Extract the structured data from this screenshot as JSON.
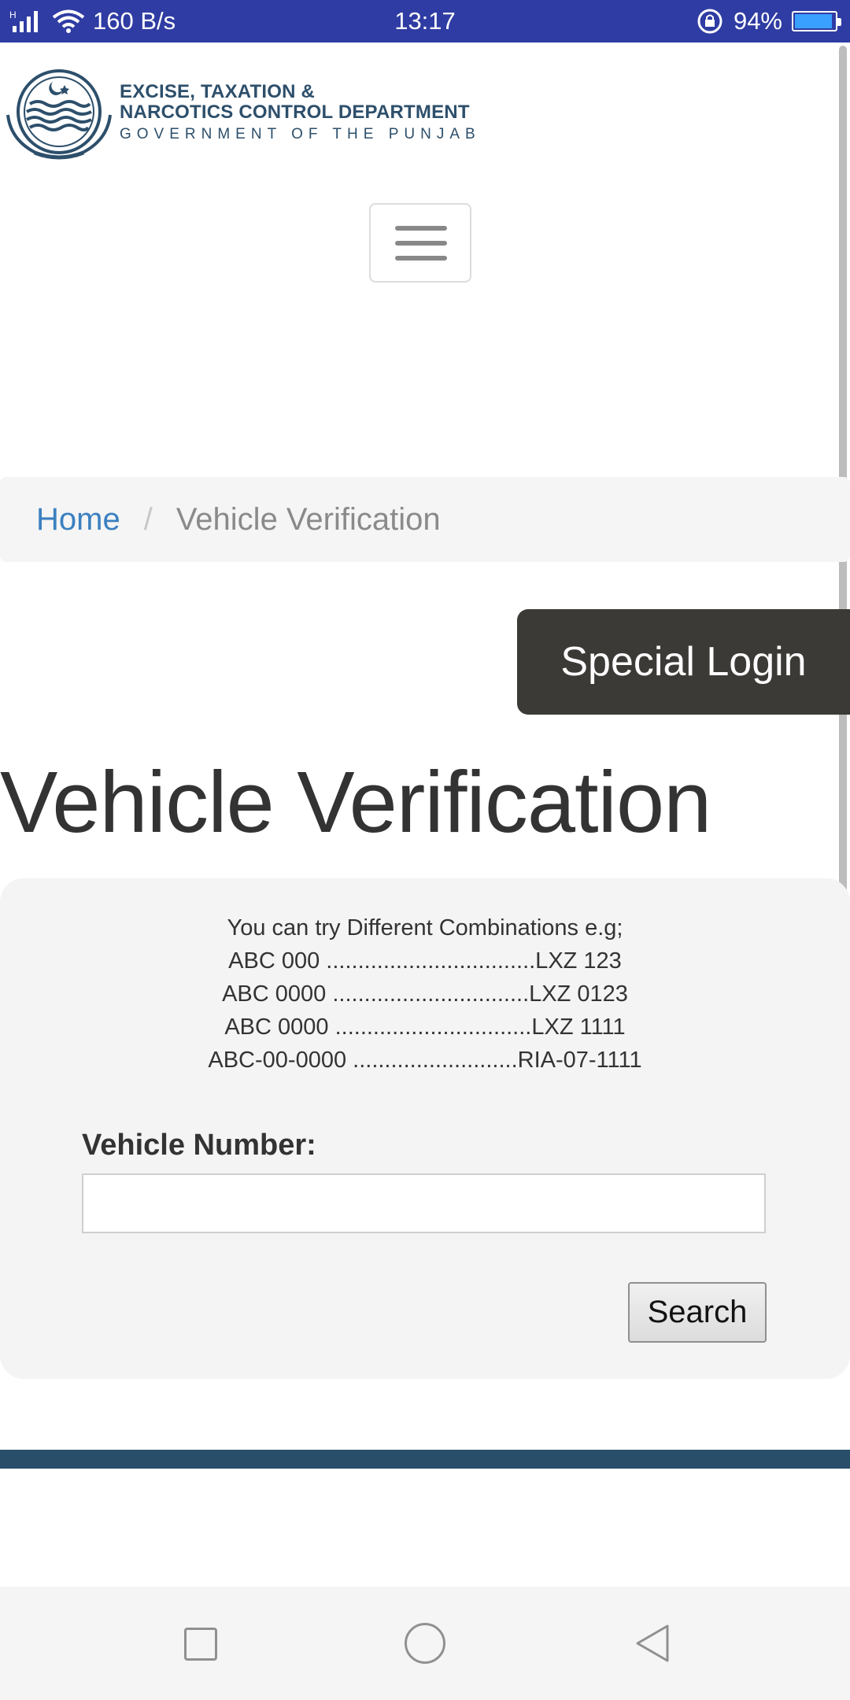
{
  "status_bar": {
    "network": "H",
    "speed": "160 B/s",
    "time": "13:17",
    "battery_percent": "94%",
    "battery_level": 0.94
  },
  "header": {
    "org_line1": "EXCISE, TAXATION &",
    "org_line2": "NARCOTICS CONTROL DEPARTMENT",
    "org_line3": "GOVERNMENT OF THE PUNJAB",
    "logo_icon": "punjab-emblem-icon",
    "menu_icon": "hamburger-menu-icon"
  },
  "breadcrumb": {
    "home": "Home",
    "separator": "/",
    "current": "Vehicle Verification"
  },
  "special_login": "Special Login",
  "page_title": "Vehicle Verification",
  "examples": {
    "intro": "You can try Different Combinations e.g;",
    "lines": [
      "ABC 000 .................................LXZ 123",
      "ABC 0000 ...............................LXZ 0123",
      "ABC 0000 ...............................LXZ 1111",
      "ABC-00-0000 ..........................RIA-07-1111"
    ]
  },
  "form": {
    "label": "Vehicle Number:",
    "value": "",
    "search_label": "Search"
  },
  "colors": {
    "status_bar": "#2f3ca3",
    "brand_text": "#2d4f6b",
    "link": "#3a80c0",
    "special_login_bg": "#3b3a36",
    "footer_line": "#294e6a"
  },
  "nav": {
    "recents_icon": "square-recents-icon",
    "home_icon": "circle-home-icon",
    "back_icon": "triangle-back-icon"
  }
}
